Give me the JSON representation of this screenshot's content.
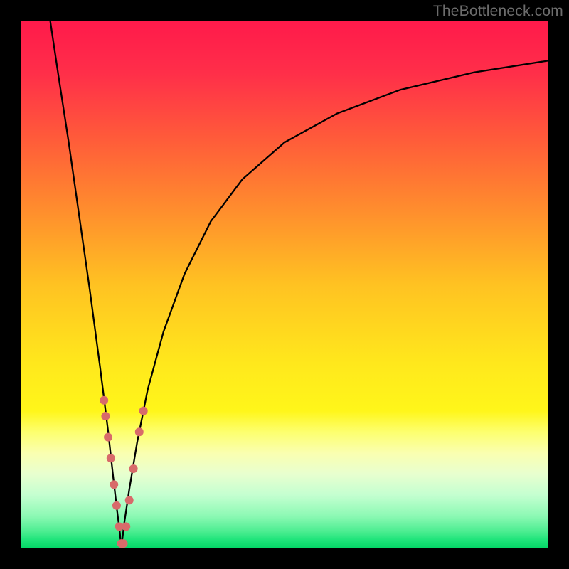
{
  "watermark": "TheBottleneck.com",
  "chart_data": {
    "type": "line",
    "title": "",
    "xlabel": "",
    "ylabel": "",
    "xlim": [
      0,
      100
    ],
    "ylim": [
      0,
      100
    ],
    "grid": false,
    "legend": false,
    "background_gradient": {
      "stops": [
        {
          "pos": 0.0,
          "color": "#ff1a4b"
        },
        {
          "pos": 0.1,
          "color": "#ff2f49"
        },
        {
          "pos": 0.22,
          "color": "#ff5a3a"
        },
        {
          "pos": 0.35,
          "color": "#ff8a2e"
        },
        {
          "pos": 0.5,
          "color": "#ffc222"
        },
        {
          "pos": 0.65,
          "color": "#ffe81c"
        },
        {
          "pos": 0.74,
          "color": "#fff61a"
        },
        {
          "pos": 0.78,
          "color": "#fdff6e"
        },
        {
          "pos": 0.82,
          "color": "#faffb0"
        },
        {
          "pos": 0.86,
          "color": "#e8ffcf"
        },
        {
          "pos": 0.9,
          "color": "#c4ffd0"
        },
        {
          "pos": 0.94,
          "color": "#8cf9b4"
        },
        {
          "pos": 0.97,
          "color": "#4aed90"
        },
        {
          "pos": 0.985,
          "color": "#1fe47a"
        },
        {
          "pos": 1.0,
          "color": "#05d767"
        }
      ]
    },
    "series": [
      {
        "name": "curve-left",
        "stroke": "#000000",
        "x": [
          5.5,
          7,
          9,
          11,
          13,
          15,
          16.5,
          17.5,
          18.2,
          18.7,
          19.0
        ],
        "y": [
          100,
          90,
          77,
          63,
          49,
          34,
          22,
          13,
          7,
          3,
          0
        ]
      },
      {
        "name": "curve-right",
        "stroke": "#000000",
        "x": [
          19.0,
          19.6,
          20.5,
          22,
          24,
          27,
          31,
          36,
          42,
          50,
          60,
          72,
          86,
          100
        ],
        "y": [
          0,
          5,
          11,
          20,
          30,
          41,
          52,
          62,
          70,
          77,
          82.5,
          87,
          90.3,
          92.5
        ]
      }
    ],
    "markers": {
      "color": "#d86a6a",
      "radius_px": 6,
      "points": [
        {
          "x": 15.7,
          "y": 28
        },
        {
          "x": 16.0,
          "y": 25
        },
        {
          "x": 16.5,
          "y": 21
        },
        {
          "x": 17.0,
          "y": 17
        },
        {
          "x": 17.6,
          "y": 12
        },
        {
          "x": 18.1,
          "y": 8
        },
        {
          "x": 18.6,
          "y": 4
        },
        {
          "x": 19.0,
          "y": 0.8
        },
        {
          "x": 19.4,
          "y": 0.8
        },
        {
          "x": 19.9,
          "y": 4
        },
        {
          "x": 20.5,
          "y": 9
        },
        {
          "x": 21.3,
          "y": 15
        },
        {
          "x": 22.4,
          "y": 22
        },
        {
          "x": 23.2,
          "y": 26
        }
      ]
    }
  }
}
